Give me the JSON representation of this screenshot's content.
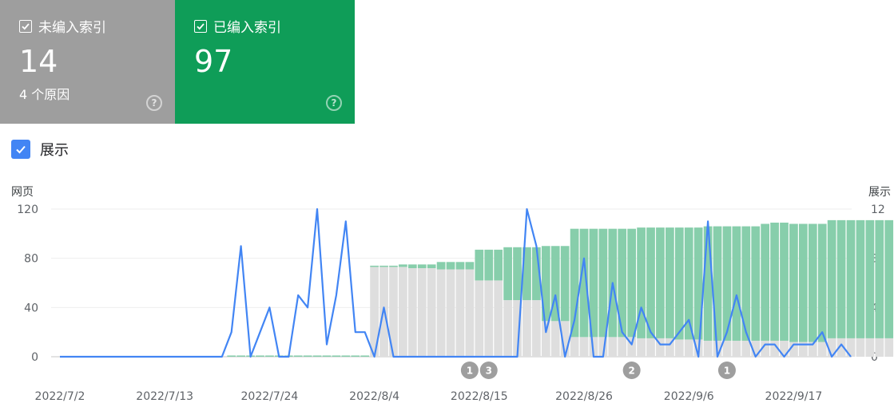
{
  "cards": [
    {
      "label": "未编入索引",
      "value": "14",
      "sub": "4 个原因",
      "color": "#9e9e9e"
    },
    {
      "label": "已编入索引",
      "value": "97",
      "sub": "",
      "color": "#0f9d58"
    }
  ],
  "help_glyph": "?",
  "legend": {
    "label": "展示",
    "checked": true,
    "color": "#4285f4"
  },
  "chart_data": {
    "type": "bar",
    "left_axis": {
      "title": "网页",
      "ticks": [
        0,
        40,
        80,
        120
      ],
      "range": [
        0,
        120
      ]
    },
    "right_axis": {
      "title": "展示",
      "ticks": [
        0,
        4,
        8,
        12
      ],
      "range": [
        0,
        12
      ]
    },
    "x_labels": [
      "2022/7/2",
      "2022/7/13",
      "2022/7/24",
      "2022/8/4",
      "2022/8/15",
      "2022/8/26",
      "2022/9/6",
      "2022/9/17"
    ],
    "x_label_days": [
      0,
      11,
      22,
      33,
      44,
      55,
      66,
      77
    ],
    "colors": {
      "not_indexed": "#dedede",
      "indexed": "#87ceab",
      "impressions": "#4285f4",
      "marker": "#9e9e9e"
    },
    "series": [
      {
        "name": "未编入索引",
        "kind": "bar",
        "values": [
          0,
          0,
          0,
          0,
          0,
          0,
          0,
          0,
          0,
          0,
          0,
          0,
          0,
          0,
          0,
          0,
          0,
          0,
          0,
          0,
          0,
          0,
          0,
          0,
          0,
          0,
          0,
          0,
          0,
          0,
          0,
          0,
          0,
          73,
          73,
          73,
          73,
          72,
          72,
          72,
          71,
          71,
          71,
          71,
          62,
          62,
          62,
          46,
          46,
          46,
          46,
          29,
          29,
          29,
          16,
          16,
          16,
          16,
          16,
          16,
          16,
          15,
          15,
          15,
          15,
          14,
          14,
          14,
          13,
          13,
          13,
          13,
          13,
          13,
          13,
          13,
          13,
          12,
          12,
          12,
          12,
          15,
          15,
          15,
          15,
          15,
          15,
          15
        ]
      },
      {
        "name": "已编入索引",
        "kind": "bar",
        "values": [
          0,
          0,
          0,
          0,
          0,
          0,
          0,
          0,
          0,
          0,
          0,
          0,
          0,
          0,
          0,
          0,
          0,
          0,
          1,
          1,
          1,
          1,
          1,
          1,
          1,
          1,
          1,
          1,
          1,
          1,
          1,
          1,
          1,
          1,
          1,
          1,
          2,
          3,
          3,
          3,
          6,
          6,
          6,
          6,
          25,
          25,
          25,
          43,
          43,
          43,
          43,
          61,
          61,
          61,
          88,
          88,
          88,
          88,
          88,
          88,
          88,
          90,
          90,
          90,
          90,
          91,
          91,
          91,
          93,
          93,
          93,
          93,
          93,
          93,
          95,
          96,
          96,
          96,
          96,
          96,
          96,
          96,
          96,
          96,
          96,
          96,
          96,
          96,
          96,
          96
        ]
      },
      {
        "name": "展示",
        "kind": "line",
        "axis": "right",
        "values": [
          0,
          0,
          0,
          0,
          0,
          0,
          0,
          0,
          0,
          0,
          0,
          0,
          0,
          0,
          0,
          0,
          0,
          0,
          2,
          9,
          0,
          2,
          4,
          0,
          0,
          5,
          4,
          12,
          1,
          5,
          11,
          2,
          2,
          0,
          4,
          0,
          0,
          0,
          0,
          0,
          0,
          0,
          0,
          0,
          0,
          0,
          0,
          0,
          0,
          12,
          9,
          2,
          5,
          0,
          3,
          8,
          0,
          0,
          6,
          2,
          1,
          4,
          2,
          1,
          1,
          2,
          3,
          0,
          11,
          0,
          2,
          5,
          2,
          0,
          1,
          1,
          0,
          1,
          1,
          1,
          2,
          0,
          1,
          0
        ]
      }
    ],
    "annotations": [
      {
        "label": "1",
        "day": 43
      },
      {
        "label": "3",
        "day": 45
      },
      {
        "label": "2",
        "day": 60
      },
      {
        "label": "1",
        "day": 70
      }
    ]
  }
}
